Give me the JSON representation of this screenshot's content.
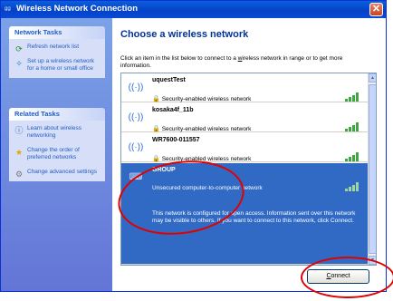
{
  "window": {
    "title": "Wireless Network Connection",
    "title_icon": "wireless-network-icon",
    "close_label": "✕"
  },
  "sidebar": {
    "network_tasks": {
      "header": "Network Tasks",
      "items": [
        {
          "label": "Refresh network list",
          "icon": "refresh-icon"
        },
        {
          "label": "Set up a wireless network for a home or small office",
          "icon": "setup-wizard-icon"
        }
      ]
    },
    "related_tasks": {
      "header": "Related Tasks",
      "items": [
        {
          "label": "Learn about wireless networking",
          "icon": "info-icon"
        },
        {
          "label": "Change the order of preferred networks",
          "icon": "star-icon"
        },
        {
          "label": "Change advanced settings",
          "icon": "settings-icon"
        }
      ]
    }
  },
  "main": {
    "heading": "Choose a wireless network",
    "intro_pre": "Click an item in the list below to connect to a ",
    "intro_underlined": "w",
    "intro_post": "ireless network in range or to get more information."
  },
  "networks": [
    {
      "name": "uquestTest",
      "security": "Security-enabled wireless network",
      "signal_bars": 4,
      "selected": false
    },
    {
      "name": "kosaka4f_11b",
      "security": "Security-enabled wireless network",
      "signal_bars": 4,
      "selected": false
    },
    {
      "name": "WR7600-011557",
      "security": "Security-enabled wireless network",
      "signal_bars": 4,
      "selected": false
    },
    {
      "name": "GROUP",
      "security": "Unsecured computer-to-computer network",
      "signal_bars": 4,
      "selected": true,
      "description": "This network is configured for open access. Information sent over this network may be visible to others. If you want to connect to this network, click Connect."
    }
  ],
  "connect_button": {
    "label_first": "C",
    "label_rest": "onnect"
  },
  "colors": {
    "accent": "#316ac5",
    "title_bar": "#0a5fdb",
    "annotation": "#e00000",
    "sidebar": "#7ba2e7"
  }
}
